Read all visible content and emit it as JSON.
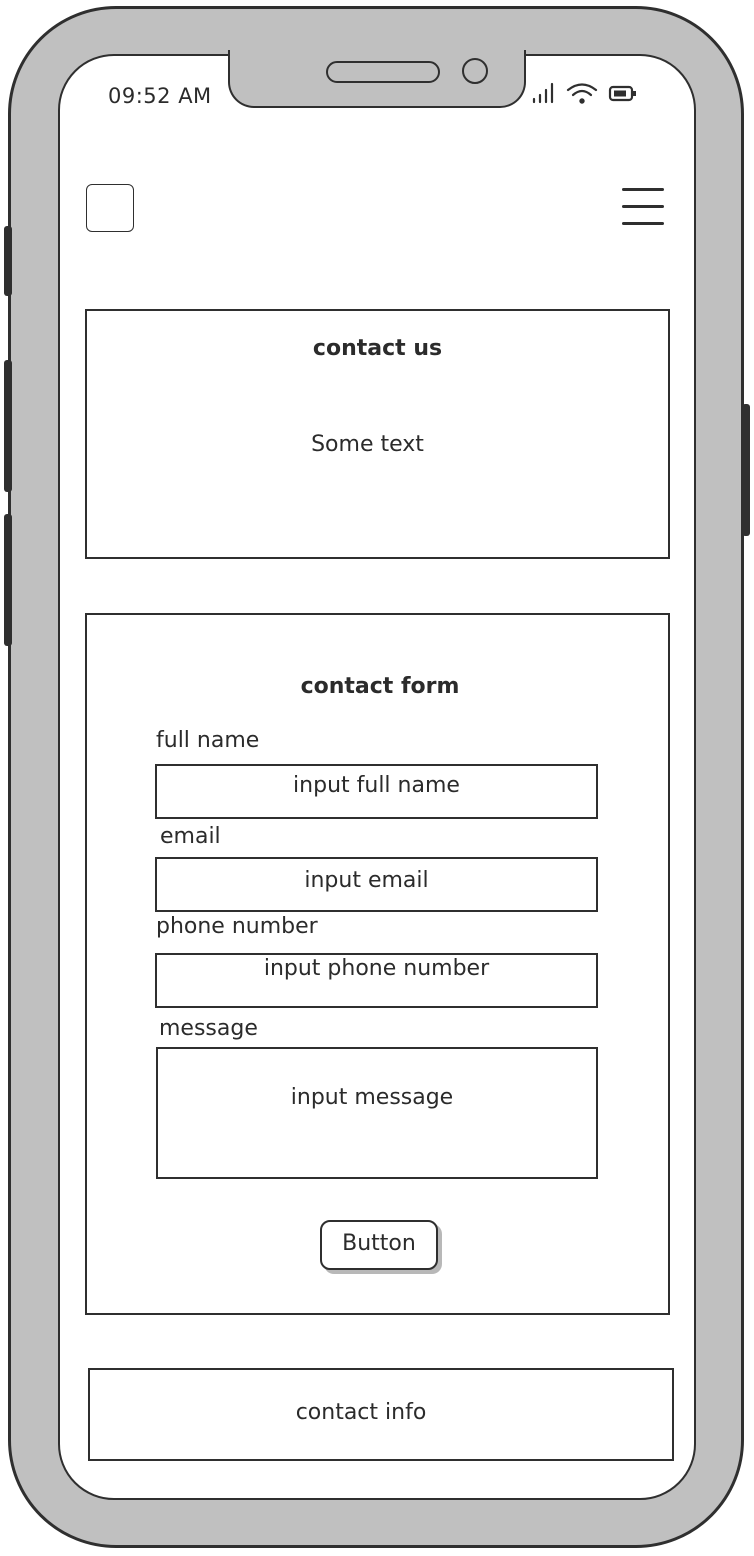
{
  "status_bar": {
    "time": "09:52 AM",
    "icons": [
      "signal-icon",
      "wifi-icon",
      "battery-icon"
    ]
  },
  "header": {
    "logo": "logo-placeholder",
    "menu_icon": "hamburger-menu-icon"
  },
  "contact_us": {
    "title": "contact us",
    "body": "Some text"
  },
  "contact_form": {
    "title": "contact form",
    "fields": [
      {
        "label": "full name",
        "placeholder": "input full name"
      },
      {
        "label": "email",
        "placeholder": "input email"
      },
      {
        "label": "phone number",
        "placeholder": "input phone number"
      },
      {
        "label": "message",
        "placeholder": "input message"
      }
    ],
    "submit_label": "Button"
  },
  "contact_info": {
    "label": "contact info"
  },
  "colors": {
    "frame": "#c0c0c0",
    "stroke": "#2f2f2f",
    "screen": "#ffffff"
  }
}
